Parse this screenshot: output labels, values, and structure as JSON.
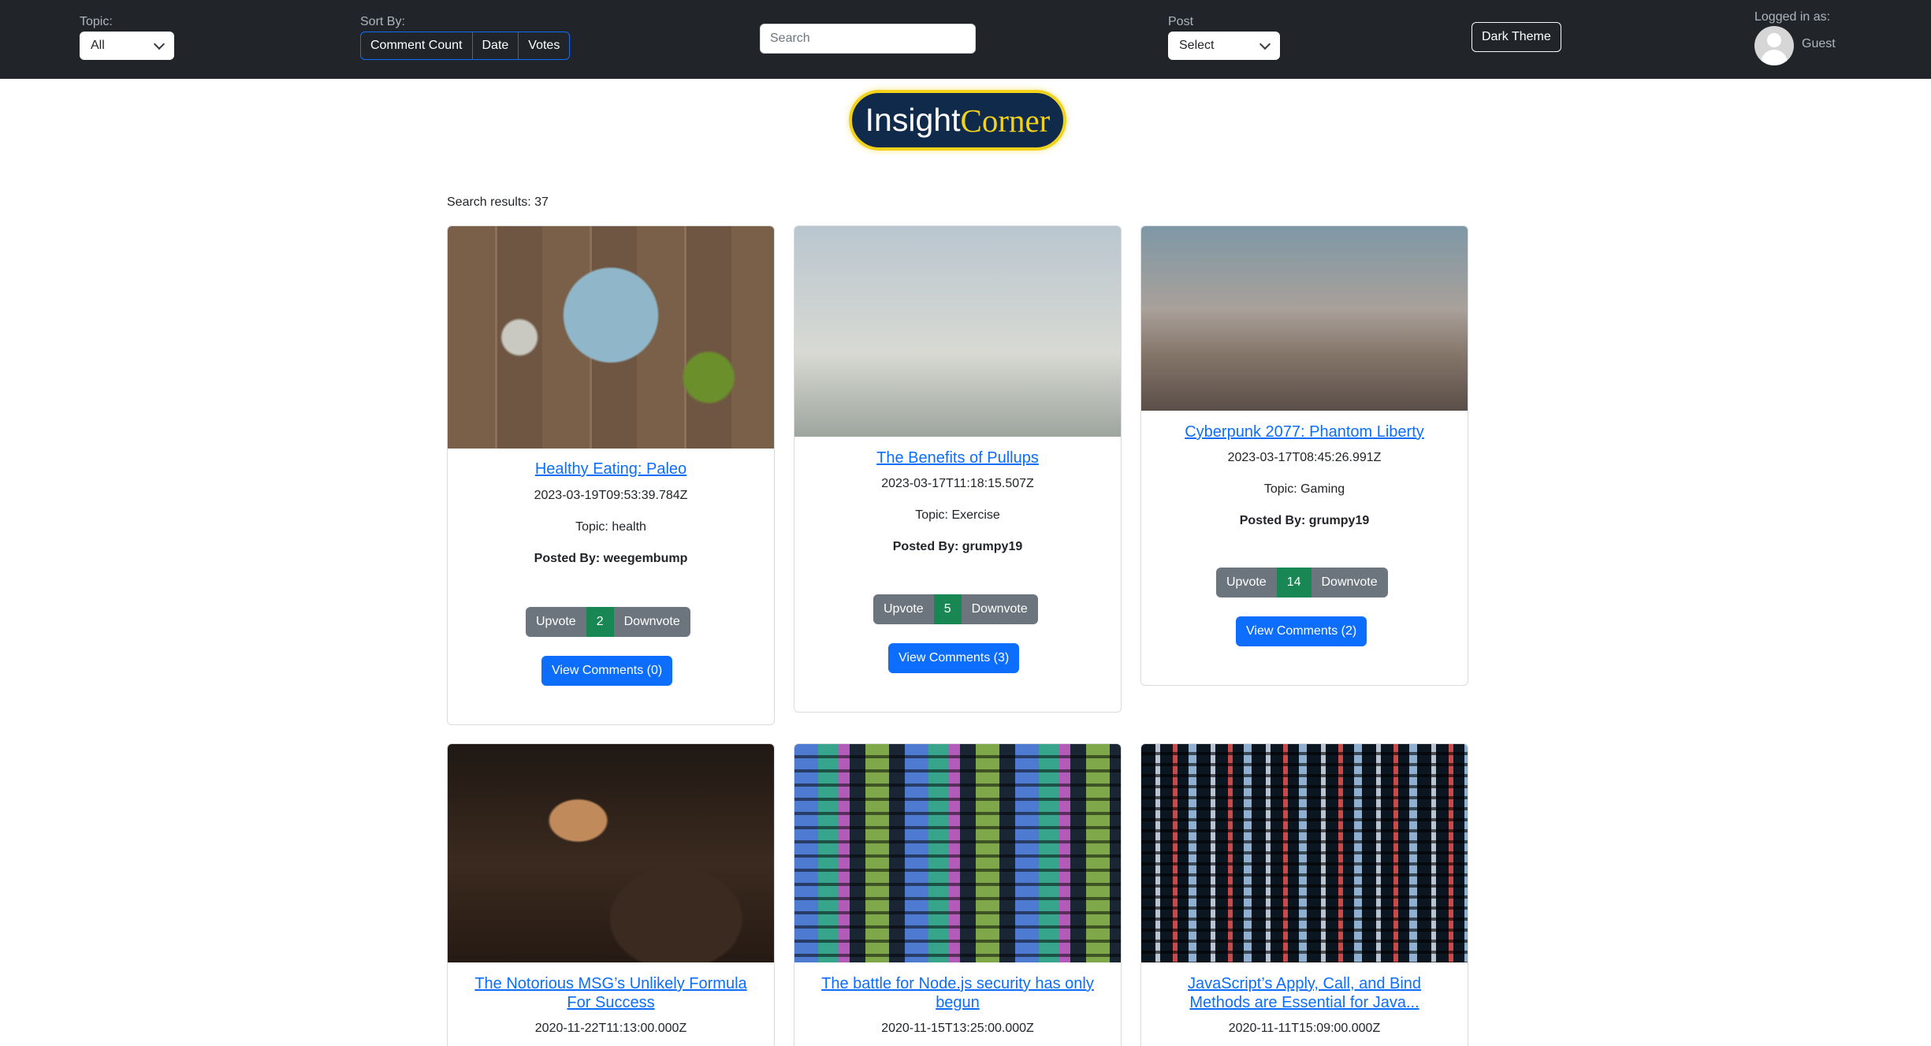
{
  "navbar": {
    "topic_label": "Topic:",
    "topic_value": "All",
    "sort_label": "Sort By:",
    "sort_options": [
      "Comment Count",
      "Date",
      "Votes"
    ],
    "search_placeholder": "Search",
    "post_label": "Post",
    "post_value": "Select",
    "theme_button": "Dark Theme",
    "logged_in_label": "Logged in as:",
    "user_name": "Guest"
  },
  "logo": {
    "part1": "Insight",
    "part2": "Corner"
  },
  "results_text": "Search results: 37",
  "posts": [
    {
      "title": "Healthy Eating: Paleo",
      "date": "2023-03-19T09:53:39.784Z",
      "topic": "Topic: health",
      "author": "Posted By: weegembump",
      "upvote": "Upvote",
      "votes": "2",
      "downvote": "Downvote",
      "comments": "View Comments (0)"
    },
    {
      "title": "The Benefits of Pullups",
      "date": "2023-03-17T11:18:15.507Z",
      "topic": "Topic: Exercise",
      "author": "Posted By: grumpy19",
      "upvote": "Upvote",
      "votes": "5",
      "downvote": "Downvote",
      "comments": "View Comments (3)"
    },
    {
      "title": "Cyberpunk 2077: Phantom Liberty",
      "date": "2023-03-17T08:45:26.991Z",
      "topic": "Topic: Gaming",
      "author": "Posted By: grumpy19",
      "upvote": "Upvote",
      "votes": "14",
      "downvote": "Downvote",
      "comments": "View Comments (2)"
    },
    {
      "title": "The Notorious MSG’s Unlikely Formula For Success",
      "date": "2020-11-22T11:13:00.000Z"
    },
    {
      "title": "The battle for Node.js security has only begun",
      "date": "2020-11-15T13:25:00.000Z"
    },
    {
      "title": "JavaScript’s Apply, Call, and Bind Methods are Essential for Java...",
      "date": "2020-11-11T15:09:00.000Z"
    }
  ]
}
